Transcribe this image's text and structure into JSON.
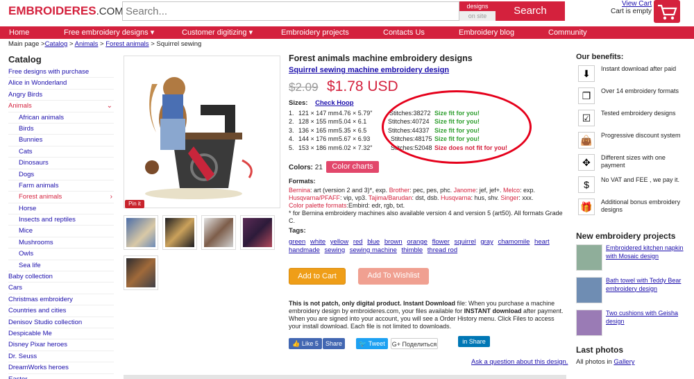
{
  "header": {
    "logo_text": "EMBROIDERES",
    "logo_domain": ".COM",
    "search_placeholder": "Search...",
    "location_top": "designs",
    "location_bottom": "on site",
    "search_button": "Search",
    "view_cart": "View Cart",
    "cart_status": "Cart is empty"
  },
  "nav": {
    "items": [
      "Home",
      "Free embroidery designs ▾",
      "Customer digitizing ▾",
      "Embroidery projects",
      "Contacts Us",
      "Embroidery blog",
      "Community"
    ]
  },
  "breadcrumb": {
    "prefix": "Main page >",
    "links": [
      "Catalog",
      "Animals",
      "Forest animals"
    ],
    "separator": " > ",
    "current": " > Squirrel sewing"
  },
  "sidebar": {
    "title": "Catalog",
    "items": [
      "Free designs with purchase",
      "Alice in Wonderland",
      "Angry Birds",
      "Animals",
      "African animals",
      "Birds",
      "Bunnies",
      "Cats",
      "Dinosaurs",
      "Dogs",
      "Farm animals",
      "Forest animals",
      "Horse",
      "Insects and reptiles",
      "Mice",
      "Mushrooms",
      "Owls",
      "Sea life",
      "Baby collection",
      "Cars",
      "Christmas embroidery",
      "Countries and cities",
      "Denisov Studio collection",
      "Despicable Me",
      "Disney Pixar heroes",
      "Dr. Seuss",
      "DreamWorks heroes",
      "Easter"
    ]
  },
  "product": {
    "pin_label": "Pin it",
    "title": "Forest animals machine embroidery designs",
    "subtitle": "Squirrel sewing machine embroidery design",
    "old_price": "$2.09",
    "price": "$1.78 USD",
    "sizes_label": "Sizes:",
    "check_hoop": "Check Hoop",
    "sizes": [
      {
        "n": "1.",
        "mm": "121 × 147 mm",
        "in": "4.76 × 5.79\"",
        "stitches": "Stitches:38272",
        "fit": "Size fit for you!"
      },
      {
        "n": "2.",
        "mm": "128 × 155 mm",
        "in": "5.04 × 6.1",
        "stitches": "Stitches:40724",
        "fit": "Size fit for you!"
      },
      {
        "n": "3.",
        "mm": "136 × 165 mm",
        "in": "5.35 × 6.5",
        "stitches": "Stitches:44337",
        "fit": "Size fit for you!"
      },
      {
        "n": "4.",
        "mm": "144 × 176 mm",
        "in": "5.67 × 6.93",
        "stitches": "Stitches:48175",
        "fit": "Size fit for you!"
      },
      {
        "n": "5.",
        "mm": "153 × 186 mm",
        "in": "6.02 × 7.32\"",
        "stitches": "Stitches:52048",
        "fit": "Size does not fit for you!"
      }
    ],
    "colors_label": "Colors:",
    "colors_count": "21",
    "color_charts": "Color charts",
    "formats_label": "Formats:",
    "formats_lines": [
      [
        "Bernina",
        ": art (version 2 and 3)*, exp. ",
        "Brother",
        ": pec, pes, phc. ",
        "Janome",
        ": jef, jef+. ",
        "Melco",
        ": exp."
      ],
      [
        "Husqvarna/PFAFF",
        ": vip, vp3. ",
        "Tajima/Barudan",
        ": dst, dsb. ",
        "Husqvarna",
        ": hus, shv. ",
        "Singer",
        ": xxx."
      ],
      [
        "Color palette formats",
        ":Embird: edr, rgb, txt."
      ]
    ],
    "formats_note": "* for Bernina embroidery machines also available version 4 and version 5 (art50). All formats Grade C.",
    "tags_label": "Tags:",
    "tags": [
      "green",
      "white",
      "yellow",
      "red",
      "blue",
      "brown",
      "orange",
      "flower",
      "squirrel",
      "gray",
      "chamomile",
      "heart",
      "handmade",
      "sewing",
      "sewing machine",
      "thimble",
      "thread rod"
    ],
    "add_to_cart": "Add to Cart",
    "add_to_wishlist": "Add To Wishlist",
    "desc_bold": "This is not patch, only digital product. Instant Download",
    "desc_text1": " file: When you purchase a machine embroidery design by embroideres.com, your files available for ",
    "desc_bold2": "INSTANT download",
    "desc_text2": " after payment. When you are signed into your account, you will see a Order History menu. Click Files to access your install download. Each file is not limited to downloads.",
    "social": {
      "like": "👍 Like 5",
      "share": "Share",
      "tweet": "🐦 Tweet",
      "gplus": "G+ Поделиться",
      "linkedin": "in Share"
    },
    "ask": "Ask a question about this design."
  },
  "benefits": {
    "title": "Our benefits:",
    "items": [
      {
        "icon": "download-icon",
        "glyph": "⬇",
        "text": "Instant download after paid"
      },
      {
        "icon": "copies-icon",
        "glyph": "❐",
        "text": "Over 14 embroidery formats"
      },
      {
        "icon": "checkbox-icon",
        "glyph": "☑",
        "text": "Tested embroidery designs"
      },
      {
        "icon": "shopping-bag-icon",
        "glyph": "👜",
        "text": "Progressive discount system"
      },
      {
        "icon": "move-arrows-icon",
        "glyph": "✥",
        "text": "Different sizes with one payment"
      },
      {
        "icon": "no-tax-icon",
        "glyph": "$",
        "text": "No VAT and FEE , we pay it."
      },
      {
        "icon": "gift-icon",
        "glyph": "🎁",
        "text": "Additional bonus embroidery designs"
      }
    ]
  },
  "new_projects": {
    "title": "New embroidery projects",
    "items": [
      {
        "title": "Embroidered kitchen napkin with Mosaic design",
        "color": "#8fae9a"
      },
      {
        "title": "Bath towel with Teddy Bear embroidery design",
        "color": "#6f8db3"
      },
      {
        "title": "Two cushions with Geisha design",
        "color": "#9a7bb5"
      }
    ]
  },
  "last_photos": {
    "title": "Last photos",
    "prefix": "All photos in ",
    "link": "Gallery"
  },
  "colors": {
    "brand_red": "#d4213d",
    "link_blue": "#1a0dab",
    "fit_green": "#2e9e2e",
    "add_cart_orange": "#ef9e18",
    "wishlist_salmon": "#f0a091",
    "highlight_circle": "#e5001b"
  }
}
